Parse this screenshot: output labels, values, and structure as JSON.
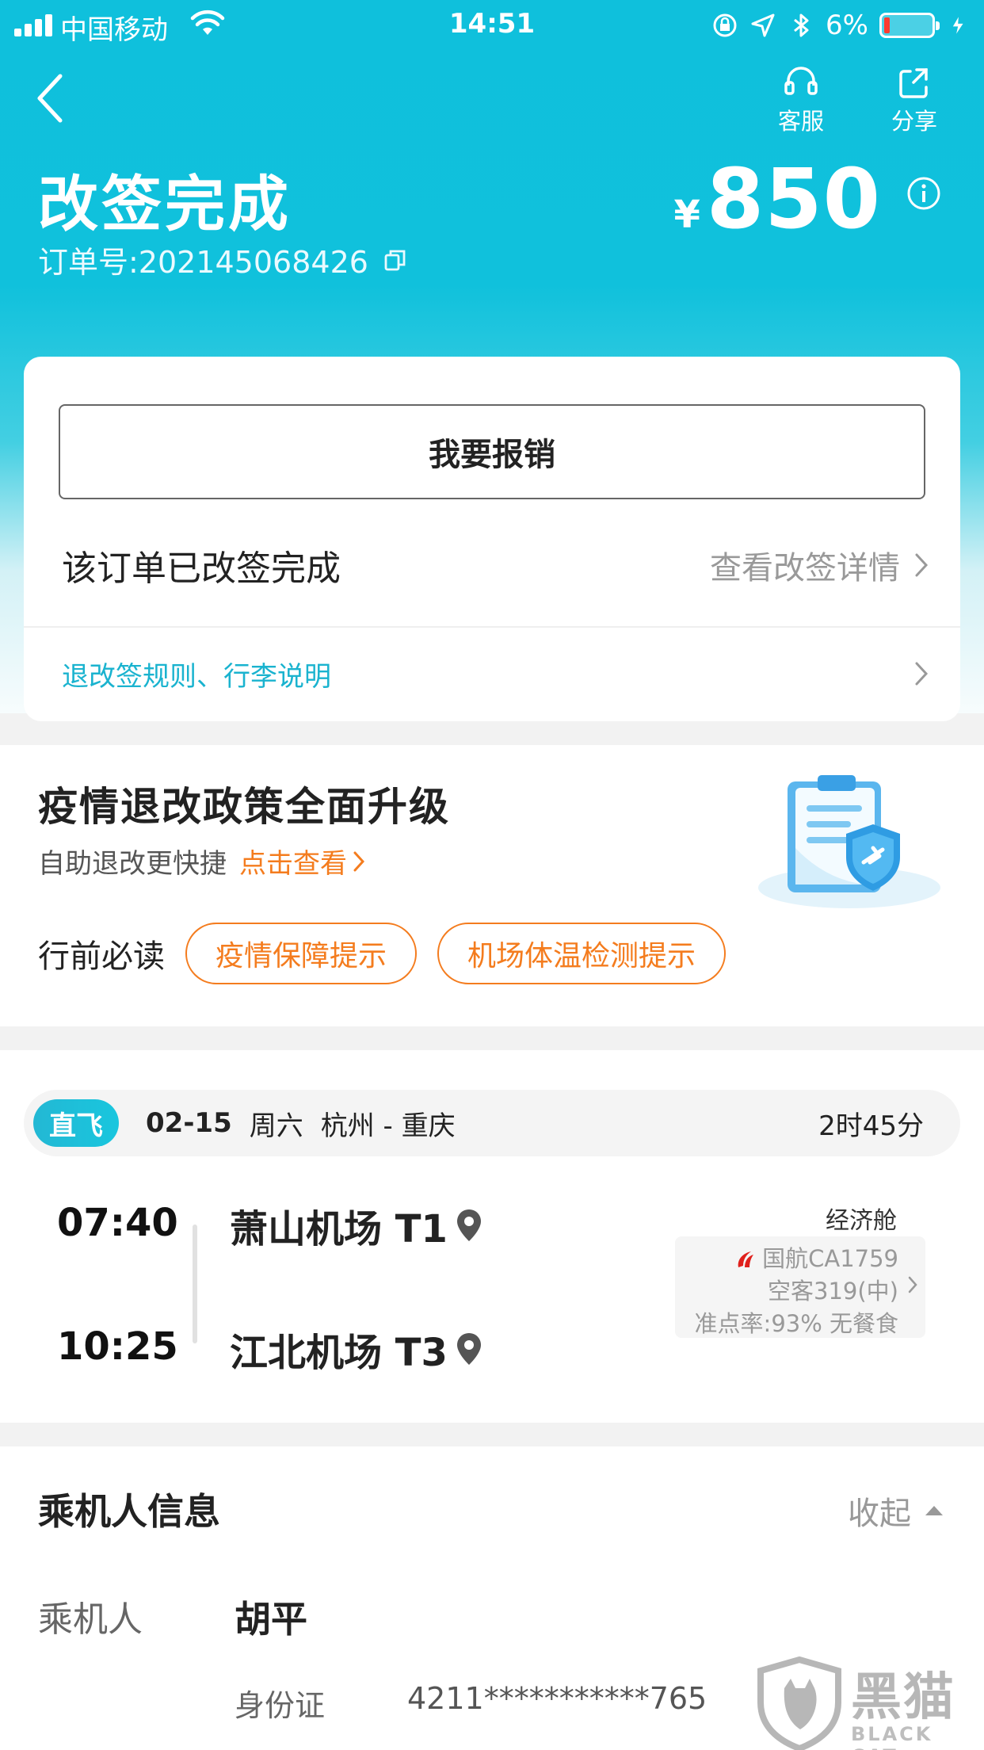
{
  "status_bar": {
    "carrier": "中国移动",
    "time": "14:51",
    "battery_percent": "6%",
    "icons": [
      "signal-icon",
      "wifi-icon",
      "lock-rotation-icon",
      "location-icon",
      "bluetooth-icon",
      "battery-icon",
      "charging-icon"
    ]
  },
  "header": {
    "title": "改签完成",
    "order_number": "订单号:202145068426",
    "currency": "¥",
    "price": "850",
    "actions": {
      "service_label": "客服",
      "share_label": "分享"
    },
    "colors": {
      "primary": "#10c1dc"
    }
  },
  "order_card": {
    "reimburse_label": "我要报销",
    "status_text": "该订单已改签完成",
    "detail_link": "查看改签详情",
    "rules_link": "退改签规则、行李说明"
  },
  "promo": {
    "title": "疫情退改政策全面升级",
    "subtitle": "自助退改更快捷",
    "link": "点击查看",
    "must_read_label": "行前必读",
    "tags": [
      "疫情保障提示",
      "机场体温检测提示"
    ],
    "accent_color": "#f47c1e"
  },
  "flight": {
    "direct_label": "直飞",
    "date": "02-15",
    "weekday": "周六",
    "route": "杭州 - 重庆",
    "duration": "2时45分",
    "departure_time": "07:40",
    "arrival_time": "10:25",
    "departure_airport": "萧山机场 T1",
    "arrival_airport": "江北机场 T3",
    "cabin": "经济舱",
    "airline": "国航CA1759",
    "aircraft": "空客319(中)",
    "punctuality": "准点率:93% 无餐食"
  },
  "passenger": {
    "section_title": "乘机人信息",
    "collapse_label": "收起",
    "passenger_label": "乘机人",
    "name": "胡平",
    "id_type": "身份证",
    "id_number": "4211***********765"
  },
  "watermark": {
    "text": "黑猫",
    "subtext": "BLACK CAT"
  }
}
